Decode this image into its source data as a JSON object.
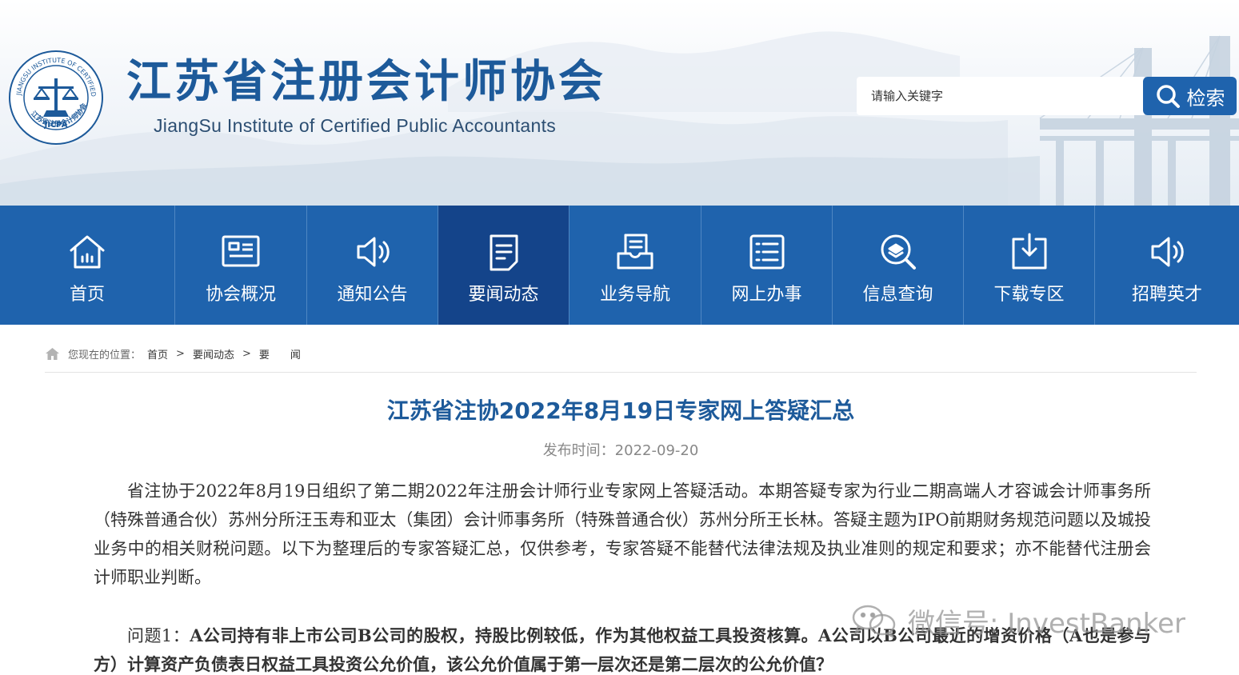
{
  "header": {
    "org_name_cn": "江苏省注册会计师协会",
    "org_name_en": "JiangSu Institute of Certified Public Accountants",
    "seal_text_outer": "JIANGSU INSTITUTE OF CERTIFIED PUBLIC ACCOUNTANTS",
    "seal_text_bottom": "江苏省注册会计师协会",
    "seal_abbr": "JICPA",
    "search_placeholder": "请输入关键字",
    "search_button": "检索"
  },
  "nav": {
    "items": [
      {
        "label": "首页",
        "icon": "home-icon"
      },
      {
        "label": "协会概况",
        "icon": "profile-card-icon"
      },
      {
        "label": "通知公告",
        "icon": "speaker-icon"
      },
      {
        "label": "要闻动态",
        "icon": "document-icon",
        "active": true
      },
      {
        "label": "业务导航",
        "icon": "book-icon"
      },
      {
        "label": "网上办事",
        "icon": "list-icon"
      },
      {
        "label": "信息查询",
        "icon": "search-layers-icon"
      },
      {
        "label": "下载专区",
        "icon": "download-icon"
      },
      {
        "label": "招聘英才",
        "icon": "speaker-icon"
      }
    ]
  },
  "breadcrumb": {
    "prefix": "您现在的位置：",
    "items": [
      "首页",
      "要闻动态",
      "要　　闻"
    ],
    "separator": ">"
  },
  "article": {
    "title": "江苏省注协2022年8月19日专家网上答疑汇总",
    "publish_time": "发布时间：2022-09-20",
    "intro": "省注协于2022年8月19日组织了第二期2022年注册会计师行业专家网上答疑活动。本期答疑专家为行业二期高端人才容诚会计师事务所（特殊普通合伙）苏州分所汪玉寿和亚太（集团）会计师事务所（特殊普通合伙）苏州分所王长林。答疑主题为IPO前期财务规范问题以及城投业务中的相关财税问题。以下为整理后的专家答疑汇总，仅供参考，专家答疑不能替代法律法规及执业准则的规定和要求；亦不能替代注册会计师职业判断。",
    "question1_prefix": "问题1：",
    "question1": "A公司持有非上市公司B公司的股权，持股比例较低，作为其他权益工具投资核算。A公司以B公司最近的增资价格（A也是参与方）计算资产负债表日权益工具投资公允价值，该公允价值属于第一层次还是第二层次的公允价值？"
  },
  "watermark": {
    "text": "微信号: InvestBanker"
  },
  "colors": {
    "brand_blue": "#1f63ad",
    "nav_active": "#14448a",
    "title_blue": "#1d5a9a"
  }
}
